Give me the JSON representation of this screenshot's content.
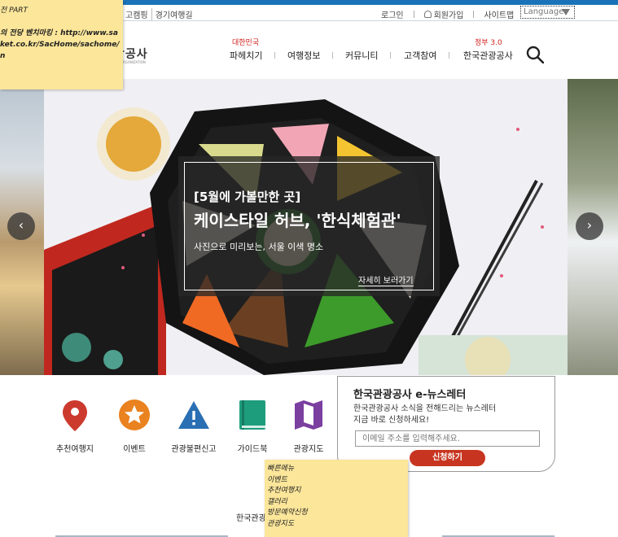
{
  "utility": {
    "left_links": [
      "고캠핑",
      "경기여행길"
    ],
    "login": "로그인",
    "signup": "회원가입",
    "sitemap": "사이트맵",
    "language": "Language"
  },
  "logo": {
    "text": "광공사",
    "sub": "ORGANIZATION"
  },
  "gnb": {
    "items": [
      "파헤치기",
      "여행정보",
      "커뮤니티",
      "고객참여",
      "한국관광공사"
    ],
    "tags": {
      "first": "대한민국",
      "last": "정부 3.0"
    }
  },
  "hero": {
    "tag": "[5월에 가볼만한 곳]",
    "title": "케이스타일 허브, '한식체험관'",
    "subtitle": "사진으로 미리보는, 서울 이색 명소",
    "more": "자세히 보러가기",
    "prev": "‹",
    "next": "›"
  },
  "quick_menu": [
    {
      "label": "추천여행지",
      "icon": "map-pin-icon",
      "color": "#cc3a2e"
    },
    {
      "label": "이벤트",
      "icon": "star-icon",
      "color": "#e9821f"
    },
    {
      "label": "관광불편신고",
      "icon": "warning-icon",
      "color": "#2a6fb3"
    },
    {
      "label": "가이드북",
      "icon": "book-icon",
      "color": "#1e9d7c"
    },
    {
      "label": "관광지도",
      "icon": "map-icon",
      "color": "#7b3fa0"
    }
  ],
  "newsletter": {
    "title": "한국관광공사 e-뉴스레터",
    "desc_1": "한국관광공사 소식을 전해드리는 뉴스레터",
    "desc_2": "지금 바로 신청하세요!",
    "placeholder": "이메일 주소를 입력해주세요.",
    "button": "신청하기"
  },
  "bottom_label": "한국관광",
  "notes": {
    "top_lines": [
      "전 PART",
      "",
      "의 전당 벤치마킹 : http://www.sa",
      "ket.co.kr/SacHome/sachome/",
      "n"
    ],
    "bottom_lines": [
      "빠른메뉴",
      "이벤트",
      "추천여행지",
      "갤러리",
      "방문예약신청",
      "관광지도"
    ]
  },
  "colors": {
    "accent": "#1a73b8",
    "button": "#c73520",
    "note": "#fbe69a"
  }
}
